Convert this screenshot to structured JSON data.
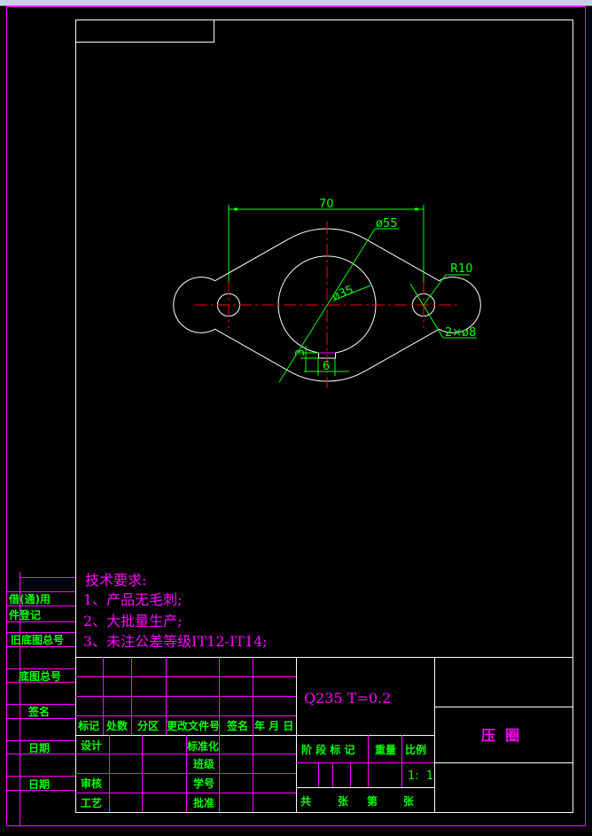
{
  "colors": {
    "background": "#000000",
    "frame": "#ffffff",
    "border": "#ff00ff",
    "text_green": "#00ff00",
    "text_magenta": "#ff00ff",
    "centerline": "#ff0000"
  },
  "dimensions": {
    "width": "70",
    "outer_dia": "ø55",
    "inner_dia": "ø35",
    "ear_radius": "R10",
    "holes": "2×ø8",
    "notch_width": "6",
    "notch_depth": "3"
  },
  "tech_requirements": {
    "title": "技术要求:",
    "items": [
      "1、产品无毛刺;",
      "2、大批量生产;",
      "3、未注公差等级IT12-IT14;"
    ]
  },
  "left_strip": {
    "labels": [
      "借(通)用",
      "件登记",
      "旧底图总号",
      "底图总号",
      "签名",
      "日期",
      "日期"
    ]
  },
  "revision_header": [
    "标记",
    "处数",
    "分区",
    "更改文件号",
    "签名",
    "年 月 日"
  ],
  "approval_labels": [
    "设计",
    "标准化",
    "班级",
    "审核",
    "学号",
    "工艺",
    "批准"
  ],
  "material": "Q235  T=0.2",
  "stage_header": [
    "阶 段 标 记",
    "重量",
    "比例"
  ],
  "scale": "1:  1",
  "sheet_line": [
    "共",
    "张",
    "第",
    "张"
  ],
  "part_name": "压  圈"
}
